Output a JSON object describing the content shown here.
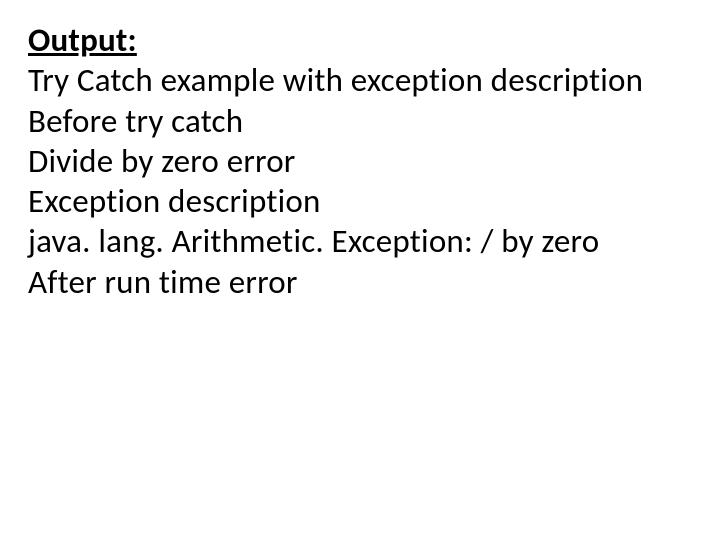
{
  "heading": "Output:",
  "lines": {
    "l1": "Try Catch example with exception description",
    "l2": "Before try catch",
    "l3": "Divide by zero error",
    "l4": "Exception description",
    "l5": "java. lang. Arithmetic. Exception: / by zero",
    "l6": "After run time error"
  }
}
